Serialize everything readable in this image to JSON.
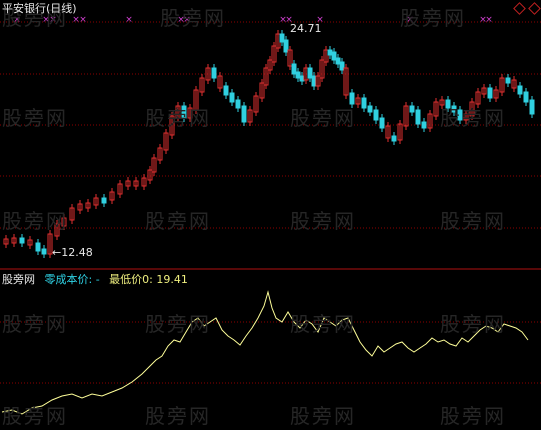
{
  "header": {
    "title": "平安银行(日线)"
  },
  "price_chart": {
    "high_label": "24.71",
    "low_label": "12.48"
  },
  "indicator": {
    "name": "股旁网",
    "zero_cost_label": "零成本价: -",
    "min_price_label": "最低价0: 19.41"
  },
  "watermark": "股旁网",
  "colors": {
    "background": "#000000",
    "up_candle": "#e03030",
    "down_candle": "#30d0e0",
    "grid": "#8b0000",
    "signal": "#d040d0",
    "indicator_line": "#ffff99"
  },
  "chart_data": {
    "type": "candlestick",
    "price_max_shown": 24.71,
    "price_min_shown": 12.48,
    "signal_markers": "magenta x marks along top edge"
  }
}
